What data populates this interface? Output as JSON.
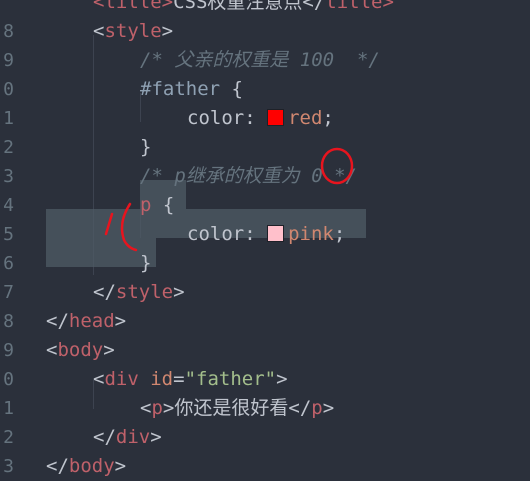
{
  "lines": [
    {
      "num": "",
      "tokens": [
        {
          "t": "<title>",
          "c": "tag"
        },
        {
          "t": "CSS权重注意点</",
          "c": "text"
        },
        {
          "t": "title>",
          "c": "tag"
        }
      ]
    },
    {
      "num": "8",
      "tokens": [
        {
          "t": "<",
          "c": "punct"
        },
        {
          "t": "style",
          "c": "tag"
        },
        {
          "t": ">",
          "c": "punct"
        }
      ]
    },
    {
      "num": "9",
      "tokens": [
        {
          "t": "/* 父亲的权重是 100  */",
          "c": "comment"
        }
      ]
    },
    {
      "num": "0",
      "tokens": [
        {
          "t": "#father",
          "c": "selector"
        },
        {
          "t": " {",
          "c": "punct"
        }
      ]
    },
    {
      "num": "1",
      "tokens": [
        {
          "t": "color",
          "c": "prop"
        },
        {
          "t": ": ",
          "c": "punct"
        },
        {
          "t": "SWATCH_RED",
          "c": "swatch"
        },
        {
          "t": "red",
          "c": "val"
        },
        {
          "t": ";",
          "c": "punct"
        }
      ]
    },
    {
      "num": "2",
      "tokens": [
        {
          "t": "}",
          "c": "punct"
        }
      ]
    },
    {
      "num": "3",
      "tokens": [
        {
          "t": "/* p继承的权重为 0 */",
          "c": "comment"
        }
      ]
    },
    {
      "num": "4",
      "tokens": [
        {
          "t": "p",
          "c": "tagsel"
        },
        {
          "t": " {",
          "c": "punct"
        }
      ]
    },
    {
      "num": "5",
      "tokens": [
        {
          "t": "color",
          "c": "prop"
        },
        {
          "t": ": ",
          "c": "punct"
        },
        {
          "t": "SWATCH_PINK",
          "c": "swatch"
        },
        {
          "t": "pink",
          "c": "val"
        },
        {
          "t": ";",
          "c": "punct"
        }
      ]
    },
    {
      "num": "6",
      "tokens": [
        {
          "t": "}",
          "c": "punct"
        }
      ]
    },
    {
      "num": "7",
      "tokens": [
        {
          "t": "</",
          "c": "punct"
        },
        {
          "t": "style",
          "c": "tag"
        },
        {
          "t": ">",
          "c": "punct"
        }
      ]
    },
    {
      "num": "8",
      "tokens": [
        {
          "t": "</",
          "c": "punct"
        },
        {
          "t": "head",
          "c": "tag"
        },
        {
          "t": ">",
          "c": "punct"
        }
      ]
    },
    {
      "num": "9",
      "tokens": [
        {
          "t": "<",
          "c": "punct"
        },
        {
          "t": "body",
          "c": "tag"
        },
        {
          "t": ">",
          "c": "punct"
        }
      ]
    },
    {
      "num": "0",
      "tokens": [
        {
          "t": "<",
          "c": "punct"
        },
        {
          "t": "div",
          "c": "tag"
        },
        {
          "t": " ",
          "c": "punct"
        },
        {
          "t": "id",
          "c": "attr"
        },
        {
          "t": "=",
          "c": "punct"
        },
        {
          "t": "\"father\"",
          "c": "str"
        },
        {
          "t": ">",
          "c": "punct"
        }
      ]
    },
    {
      "num": "1",
      "tokens": [
        {
          "t": "<",
          "c": "punct"
        },
        {
          "t": "p",
          "c": "tag"
        },
        {
          "t": ">",
          "c": "punct"
        },
        {
          "t": "你还是很好看",
          "c": "text"
        },
        {
          "t": "</",
          "c": "punct"
        },
        {
          "t": "p",
          "c": "tag"
        },
        {
          "t": ">",
          "c": "punct"
        }
      ]
    },
    {
      "num": "2",
      "tokens": [
        {
          "t": "</",
          "c": "punct"
        },
        {
          "t": "div",
          "c": "tag"
        },
        {
          "t": ">",
          "c": "punct"
        }
      ]
    },
    {
      "num": "3",
      "tokens": [
        {
          "t": "</",
          "c": "punct"
        },
        {
          "t": "body",
          "c": "tag"
        },
        {
          "t": ">",
          "c": "punct"
        }
      ]
    }
  ],
  "colors": {
    "background": "#2b303b",
    "swatch_red": "#ff0000",
    "swatch_pink": "#ffc0cb",
    "annotation_red": "#e8141e",
    "selection": "#4f5b66"
  }
}
